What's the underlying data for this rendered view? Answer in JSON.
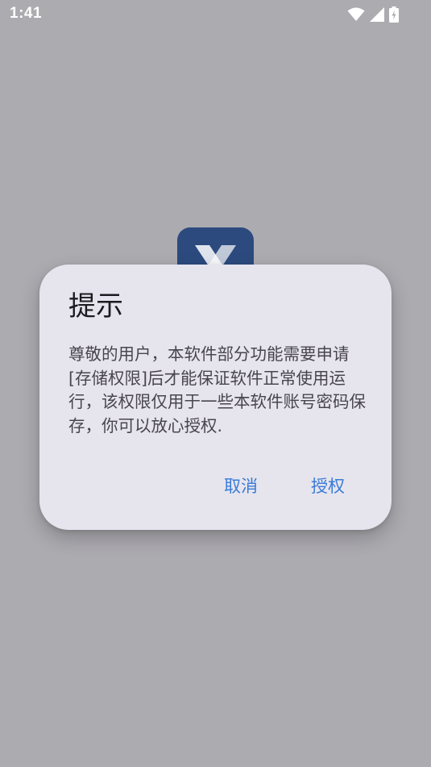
{
  "status_bar": {
    "time": "1:41",
    "icons": [
      "wifi-icon",
      "cellular-signal-icon",
      "battery-charging-icon"
    ]
  },
  "app_icon": {
    "icon": "app-logo-x-icon",
    "background_color": "#2c4a7e"
  },
  "dialog": {
    "title": "提示",
    "message": "尊敬的用户，本软件部分功能需要申请[存储权限]后才能保证软件正常使用运行，该权限仅用于一些本软件账号密码保存，你可以放心授权.",
    "cancel_label": "取消",
    "confirm_label": "授权",
    "accent_color": "#3a7bd5"
  },
  "colors": {
    "scrim": "#acabb0",
    "dialog_surface": "#e6e5ee"
  }
}
